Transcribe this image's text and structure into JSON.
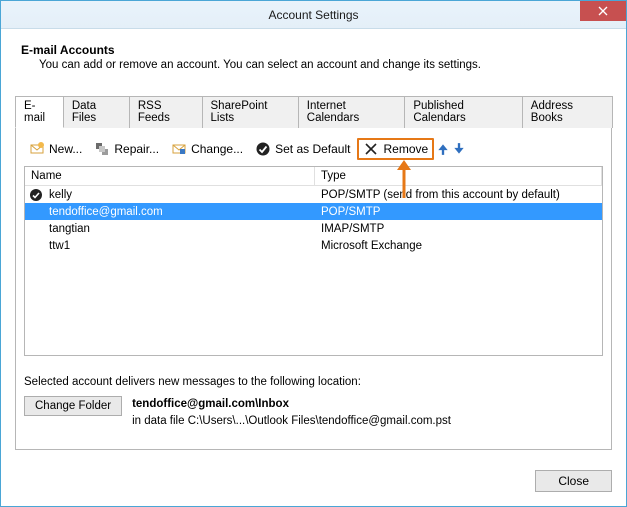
{
  "window": {
    "title": "Account Settings"
  },
  "header": {
    "heading": "E-mail Accounts",
    "sub": "You can add or remove an account. You can select an account and change its settings."
  },
  "tabs": [
    {
      "label": "E-mail",
      "active": true
    },
    {
      "label": "Data Files"
    },
    {
      "label": "RSS Feeds"
    },
    {
      "label": "SharePoint Lists"
    },
    {
      "label": "Internet Calendars"
    },
    {
      "label": "Published Calendars"
    },
    {
      "label": "Address Books"
    }
  ],
  "toolbar": {
    "new": "New...",
    "repair": "Repair...",
    "change": "Change...",
    "set_default": "Set as Default",
    "remove": "Remove"
  },
  "list": {
    "cols": {
      "name": "Name",
      "type": "Type"
    },
    "rows": [
      {
        "name": "kelly",
        "type": "POP/SMTP (send from this account by default)",
        "default": true,
        "selected": false
      },
      {
        "name": "tendoffice@gmail.com",
        "type": "POP/SMTP",
        "default": false,
        "selected": true
      },
      {
        "name": "tangtian",
        "type": "IMAP/SMTP",
        "default": false,
        "selected": false
      },
      {
        "name": "ttw1",
        "type": "Microsoft Exchange",
        "default": false,
        "selected": false
      }
    ]
  },
  "location": {
    "intro": "Selected account delivers new messages to the following location:",
    "change_folder": "Change Folder",
    "path_bold": "tendoffice@gmail.com\\Inbox",
    "path_detail": "in data file C:\\Users\\...\\Outlook Files\\tendoffice@gmail.com.pst"
  },
  "footer": {
    "close": "Close"
  }
}
